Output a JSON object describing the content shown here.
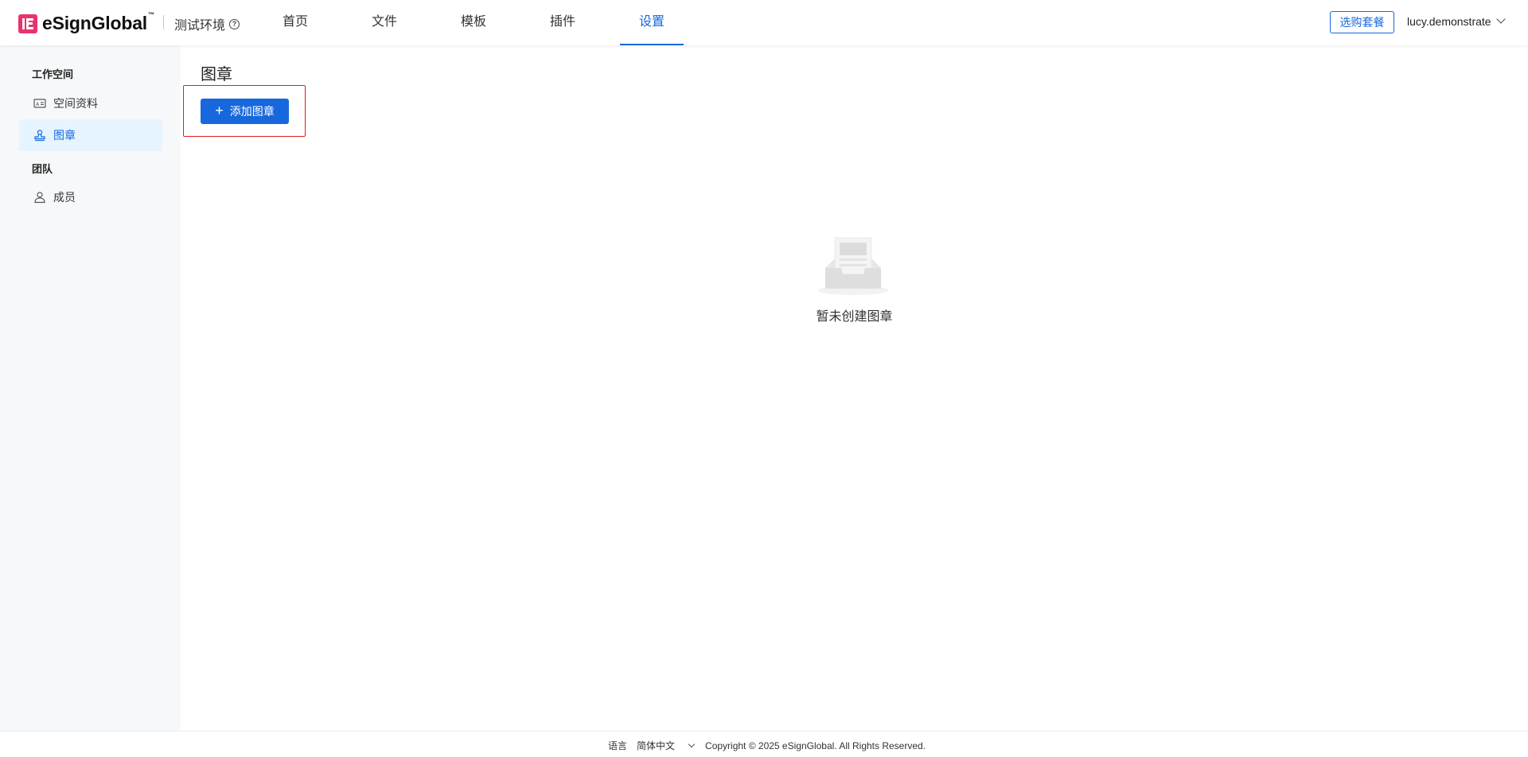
{
  "header": {
    "brand": "eSignGlobal",
    "brand_tm": "™",
    "environment": "测试环境",
    "help_glyph": "?",
    "nav": [
      {
        "label": "首页",
        "active": false
      },
      {
        "label": "文件",
        "active": false
      },
      {
        "label": "模板",
        "active": false
      },
      {
        "label": "插件",
        "active": false
      },
      {
        "label": "设置",
        "active": true
      }
    ],
    "plan_button": "选购套餐",
    "user_name": "lucy.demonstrate"
  },
  "sidebar": {
    "groups": [
      {
        "title": "工作空间",
        "items": [
          {
            "label": "空间资料",
            "icon": "id-card-icon",
            "active": false
          },
          {
            "label": "图章",
            "icon": "stamp-icon",
            "active": true
          }
        ]
      },
      {
        "title": "团队",
        "items": [
          {
            "label": "成员",
            "icon": "user-icon",
            "active": false
          }
        ]
      }
    ]
  },
  "main": {
    "title": "图章",
    "add_button": "添加图章",
    "add_icon": "+",
    "empty_icon": "empty-inbox-icon",
    "empty_text": "暂未创建图章"
  },
  "footer": {
    "language_label": "语言",
    "language_value": "简体中文",
    "copyright": "Copyright © 2025 eSignGlobal. All Rights Reserved."
  },
  "colors": {
    "accent": "#1668dc",
    "brand": "#e8336d",
    "highlight": "#e02020",
    "sidebar_bg": "#f7f8fa",
    "active_bg": "#e6f4ff"
  }
}
